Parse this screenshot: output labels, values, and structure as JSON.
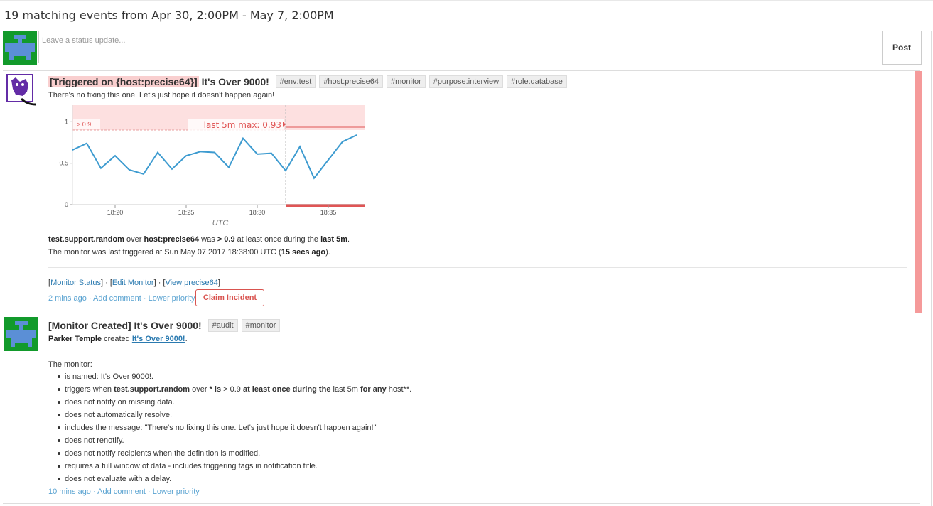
{
  "header": {
    "title": "19 matching events from Apr 30, 2:00PM - May 7, 2:00PM"
  },
  "status": {
    "placeholder": "Leave a status update...",
    "post_label": "Post"
  },
  "event1": {
    "title_highlight": "[Triggered on {host:precise64}]",
    "title_rest": " It's Over 9000!",
    "tags": [
      "#env:test",
      "#host:precise64",
      "#monitor",
      "#purpose:interview",
      "#role:database"
    ],
    "message": "There's no fixing this one. Let's just hope it doesn't happen again!",
    "summary": {
      "metric": "test.support.random",
      "over": " over ",
      "host": "host:precise64",
      "was": " was ",
      "cond": "> 0.9",
      "mid": " at least once during the ",
      "window": "last 5m",
      "end": "."
    },
    "last_triggered": {
      "text": "The monitor was last triggered at Sun May 07 2017 18:38:00 UTC (",
      "ago": "15 secs ago",
      "end": ")."
    },
    "links": {
      "monitor_status": "Monitor Status",
      "edit_monitor": "Edit Monitor",
      "view_host": "View precise64"
    },
    "meta": {
      "time": "2 mins ago",
      "add_comment": "Add comment",
      "lower_priority": "Lower priority"
    },
    "claim_label": "Claim Incident"
  },
  "chart_data": {
    "type": "line",
    "x": [
      "18:17",
      "18:18",
      "18:19",
      "18:20",
      "18:21",
      "18:22",
      "18:23",
      "18:24",
      "18:25",
      "18:26",
      "18:27",
      "18:28",
      "18:29",
      "18:30",
      "18:31",
      "18:32",
      "18:33",
      "18:34",
      "18:35",
      "18:36",
      "18:37"
    ],
    "values": [
      0.66,
      0.74,
      0.44,
      0.59,
      0.42,
      0.37,
      0.63,
      0.43,
      0.59,
      0.64,
      0.63,
      0.45,
      0.8,
      0.61,
      0.62,
      0.41,
      0.7,
      0.32,
      0.54,
      0.76,
      0.84
    ],
    "x_ticks": [
      "18:20",
      "18:25",
      "18:30",
      "18:35"
    ],
    "y_ticks": [
      "0",
      "0.5",
      "1"
    ],
    "ylim": [
      0,
      1.2
    ],
    "threshold": 0.9,
    "threshold_label": "> 0.9",
    "max_label": "last 5m max: 0.93",
    "xlabel": "UTC",
    "colors": {
      "line": "#3d9bd0",
      "alert": "#fde0e0",
      "threshold": "#e05555"
    }
  },
  "event2": {
    "title": "[Monitor Created] It's Over 9000!",
    "tags": [
      "#audit",
      "#monitor"
    ],
    "creator": "Parker Temple",
    "created": " created ",
    "monitor_link": "It's Over 9000!",
    "dot": ".",
    "intro": "The monitor:",
    "bullets": {
      "b1": "is named: It's Over 9000!.",
      "b2a": "triggers when ",
      "b2b": "test.support.random",
      "b2c": " over ",
      "b2d": "* is",
      "b2e": " > 0.9 ",
      "b2f": "at least once during the",
      "b2g": " last 5m ",
      "b2h": "for any",
      "b2i": " host**.",
      "b3": "does not notify on missing data.",
      "b4": "does not automatically resolve.",
      "b5": "includes the message: \"There's no fixing this one. Let's just hope it doesn't happen again!\"",
      "b6": "does not renotify.",
      "b7": "does not notify recipients when the definition is modified.",
      "b8": "requires a full window of data - includes triggering tags in notification title.",
      "b9": "does not evaluate with a delay."
    },
    "meta": {
      "time": "10 mins ago",
      "add_comment": "Add comment",
      "lower_priority": "Lower priority"
    }
  }
}
